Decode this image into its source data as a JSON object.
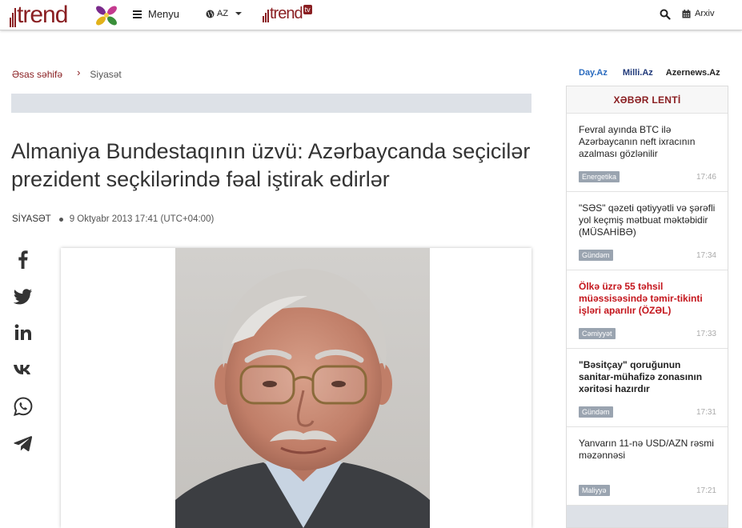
{
  "header": {
    "logo_text": "trend",
    "menu_label": "Menyu",
    "language": "AZ",
    "tv_logo_text": "trend",
    "tv_badge": "tv",
    "archive_label": "Arxiv",
    "brand_color": "#8a1f22"
  },
  "breadcrumb": {
    "home": "Əsas səhifə",
    "separator": "›",
    "current": "Siyasət"
  },
  "article": {
    "title": "Almaniya Bundestaqının üzvü: Azərbaycanda seçicilər prezident seçkilərində fəal iştirak edirlər",
    "category": "SİYASƏT",
    "date": "9 Oktyabr 2013 17:41 (UTC+04:00)"
  },
  "share": {
    "icons": [
      "facebook-icon",
      "twitter-icon",
      "linkedin-icon",
      "vk-icon",
      "whatsapp-icon",
      "telegram-icon"
    ]
  },
  "partners": [
    "Day.Az",
    "Milli.Az",
    "Azernews.Az"
  ],
  "news_feed": {
    "title": "XƏBƏR LENTİ",
    "items": [
      {
        "title": "Fevral ayında BTC ilə Azərbaycanın neft ixracının azalması gözlənilir",
        "tag": "Energetika",
        "time": "17:46",
        "style": "normal"
      },
      {
        "title": "\"SƏS\" qəzeti qətiyyətli və şərəfli yol keçmiş mətbuat məktəbidir (MÜSAHİBƏ)",
        "tag": "Gündəm",
        "time": "17:34",
        "style": "normal"
      },
      {
        "title": "Ölkə üzrə 55 təhsil müəssisəsində təmir-tikinti işləri aparılır (ÖZƏL)",
        "tag": "Cəmiyyət",
        "time": "17:33",
        "style": "red"
      },
      {
        "title": "\"Bəsitçay\" qoruğunun sanitar-mühafizə zonasının xəritəsi hazırdır",
        "tag": "Gündəm",
        "time": "17:31",
        "style": "bold"
      },
      {
        "title": "Yanvarın 11-nə USD/AZN rəsmi məzənnəsi",
        "tag": "Maliyyə",
        "time": "17:21",
        "style": "normal"
      }
    ]
  }
}
